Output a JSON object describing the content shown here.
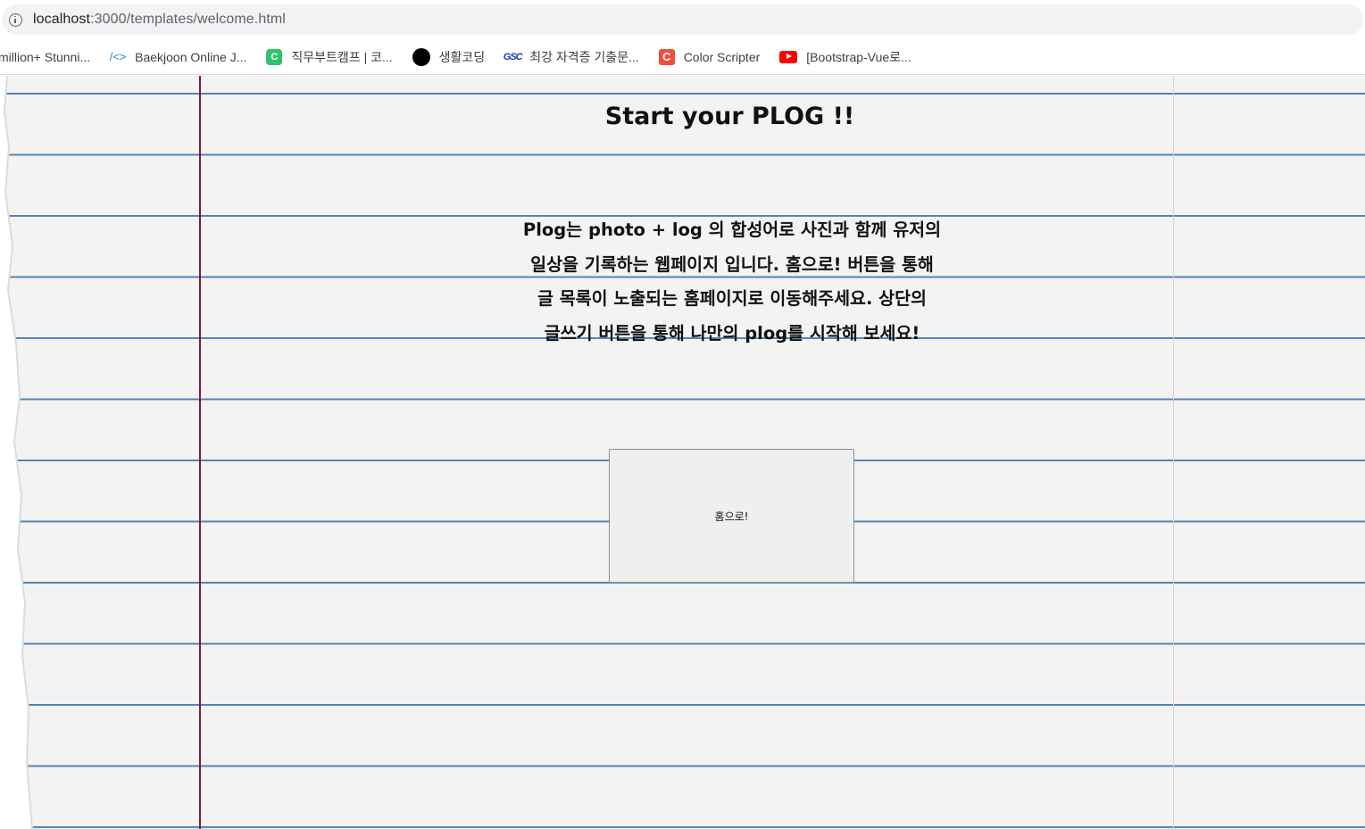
{
  "browser": {
    "url_host": "localhost",
    "url_rest": ":3000/templates/welcome.html",
    "bookmarks": [
      {
        "label": "million+ Stunni...",
        "icon": "none"
      },
      {
        "label": "Baekjoon Online J...",
        "icon": "code-icon"
      },
      {
        "label": "직무부트캠프 | 코...",
        "icon": "green-c-icon"
      },
      {
        "label": "생활코딩",
        "icon": "black-circle-icon"
      },
      {
        "label": "최강 자격증 기출문...",
        "icon": "gsc-icon"
      },
      {
        "label": "Color Scripter",
        "icon": "red-c-icon"
      },
      {
        "label": "[Bootstrap-Vue로...",
        "icon": "youtube-icon"
      }
    ]
  },
  "main": {
    "title": "Start your PLOG !!",
    "description_lines": [
      "Plog는 photo + log 의 합성어로 사진과 함께 유저의",
      "일상을 기록하는 웹페이지 입니다. 홈으로! 버튼을 통해",
      "글 목록이 노출되는 홈페이지로 이동해주세요. 상단의",
      "글쓰기 버튼을 통해 나만의 plog를 시작해 보세요!"
    ],
    "home_button_label": "홈으로!"
  },
  "colors": {
    "paper": "#f3f3f2",
    "rule_line": "#3f73a8",
    "margin_line": "#8a1438"
  }
}
